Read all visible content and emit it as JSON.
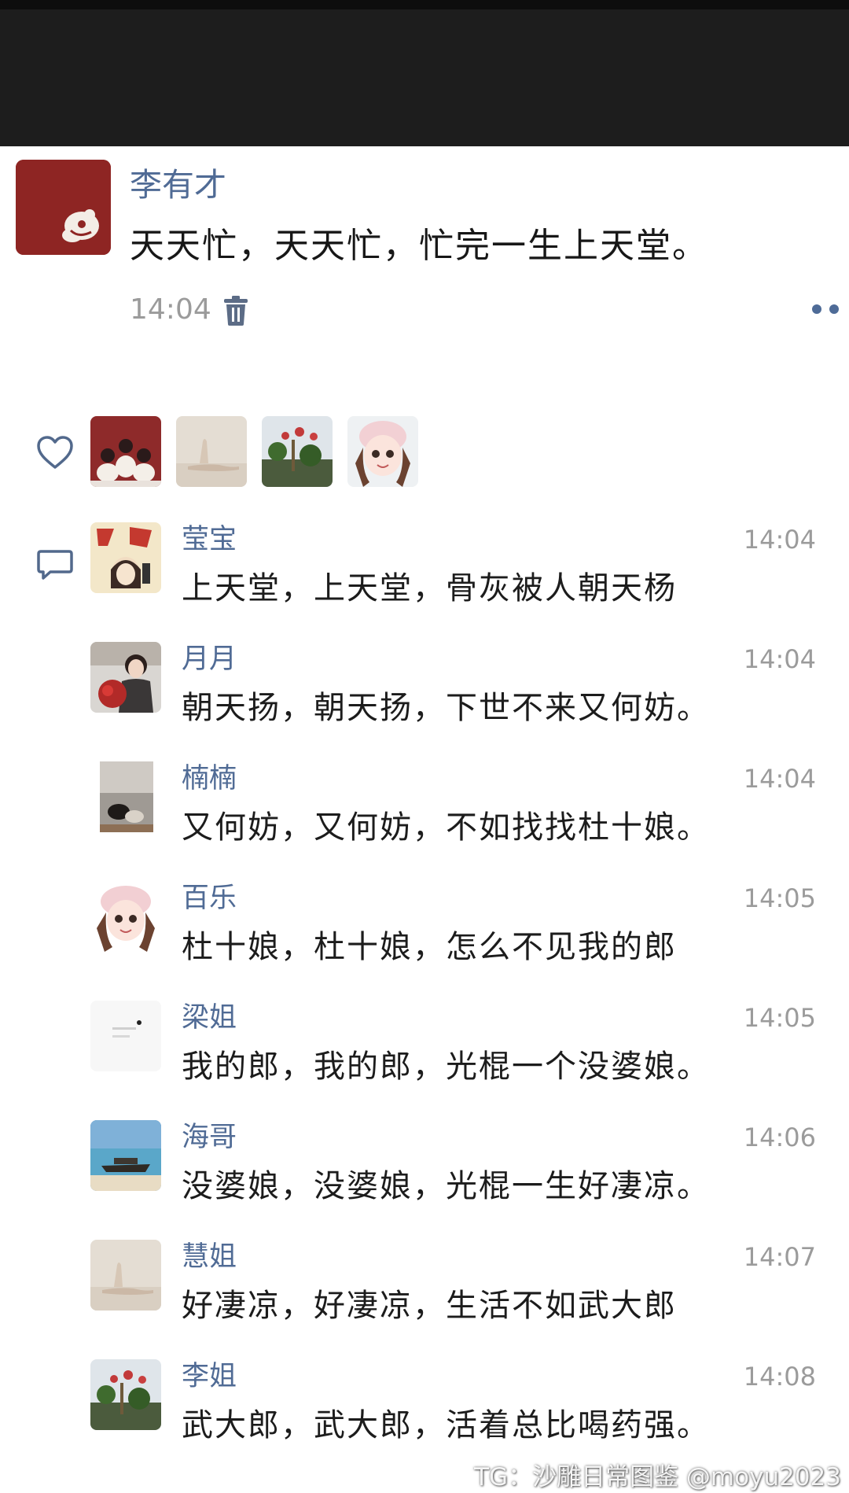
{
  "post": {
    "author": "李有才",
    "text": "天天忙，天天忙，忙完一生上天堂。",
    "time": "14:04"
  },
  "icons": {
    "delete": "trash-icon",
    "more": "more-dots-icon",
    "like": "heart-outline-icon",
    "comment": "comment-bubble-icon"
  },
  "comments": [
    {
      "name": "莹宝",
      "time": "14:04",
      "text": "上天堂，上天堂，骨灰被人朝天杨"
    },
    {
      "name": "月月",
      "time": "14:04",
      "text": "朝天扬，朝天扬，下世不来又何妨。"
    },
    {
      "name": "楠楠",
      "time": "14:04",
      "text": "又何妨，又何妨，不如找找杜十娘。"
    },
    {
      "name": "百乐",
      "time": "14:05",
      "text": "杜十娘，杜十娘，怎么不见我的郎"
    },
    {
      "name": "梁姐",
      "time": "14:05",
      "text": "我的郎，我的郎，光棍一个没婆娘。"
    },
    {
      "name": "海哥",
      "time": "14:06",
      "text": "没婆娘，没婆娘，光棍一生好凄凉。"
    },
    {
      "name": "慧姐",
      "time": "14:07",
      "text": "好凄凉，好凄凉，生活不如武大郎"
    },
    {
      "name": "李姐",
      "time": "14:08",
      "text": "武大郎，武大郎，活着总比喝药强。"
    }
  ],
  "watermark": "TG：沙雕日常图鉴 @moyu2023"
}
